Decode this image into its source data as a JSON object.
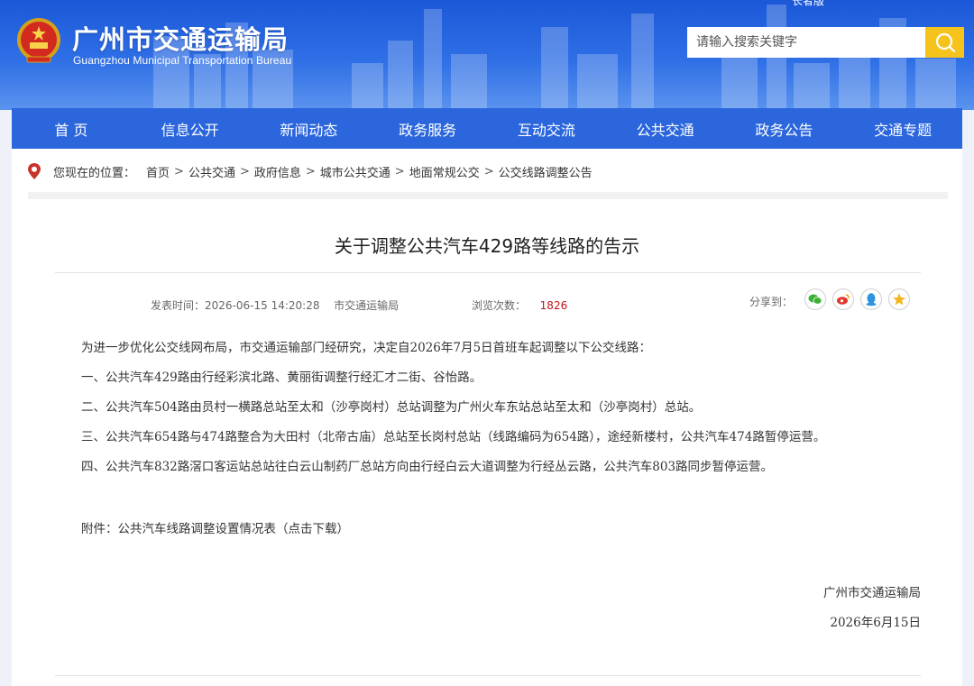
{
  "header": {
    "site_name": "广州市交通运输局",
    "site_name_en": "Guangzhou Municipal Transportation Bureau",
    "elder_mode": "长者版",
    "search_placeholder": "请输入搜索关键字",
    "colors": {
      "header_blue": "#2b66dd",
      "search_button": "#f6c31c"
    }
  },
  "nav": {
    "items": [
      "首 页",
      "信息公开",
      "新闻动态",
      "政务服务",
      "互动交流",
      "公共交通",
      "政务公告",
      "交通专题"
    ]
  },
  "breadcrumb": {
    "prefix": "您现在的位置：",
    "items": [
      "首页",
      "公共交通",
      "政府信息",
      "城市公共交通",
      "地面常规公交",
      "公交线路调整公告"
    ],
    "separator": ">"
  },
  "article": {
    "title": "关于调整公共汽车429路等线路的告示",
    "publish_label": "发表时间：",
    "publish_time": "2026-06-15 14:20:28",
    "source": "市交通运输局",
    "views_label": "浏览次数：",
    "views_count": "1826",
    "share_label": "分享到：",
    "share_icons": [
      "wechat-icon",
      "weibo-icon",
      "qq-icon",
      "qzone-icon"
    ],
    "paragraphs": [
      "为进一步优化公交线网布局，市交通运输部门经研究，决定自2026年7月5日首班车起调整以下公交线路：",
      "一、公共汽车429路由行经彩滨北路、黄丽街调整行经汇才二街、谷怡路。",
      "二、公共汽车504路由员村一横路总站至太和（沙亭岗村）总站调整为广州火车东站总站至太和（沙亭岗村）总站。",
      "三、公共汽车654路与474路整合为大田村（北帝古庙）总站至长岗村总站（线路编码为654路），途经新楼村，公共汽车474路暂停运营。",
      "四、公共汽车832路滘口客运站总站往白云山制药厂总站方向由行经白云大道调整为行经丛云路，公共汽车803路同步暂停运营。"
    ],
    "attachment_label": "附件：",
    "attachment_text": "公共汽车线路调整设置情况表（点击下载）",
    "signature_org": "广州市交通运输局",
    "signature_date": "2026年6月15日"
  }
}
